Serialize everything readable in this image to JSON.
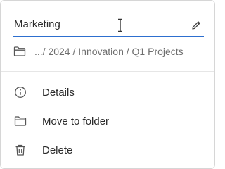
{
  "rename": {
    "value": "Marketing"
  },
  "breadcrumb": {
    "path": ".../ 2024 / Innovation / Q1 Projects"
  },
  "menu": {
    "items": [
      {
        "label": "Details",
        "icon": "info-icon"
      },
      {
        "label": "Move to folder",
        "icon": "folder-icon"
      },
      {
        "label": "Delete",
        "icon": "trash-icon"
      }
    ]
  },
  "colors": {
    "accent": "#2d6fcf",
    "text": "#2b2b2b",
    "muted": "#6f6f6f"
  }
}
